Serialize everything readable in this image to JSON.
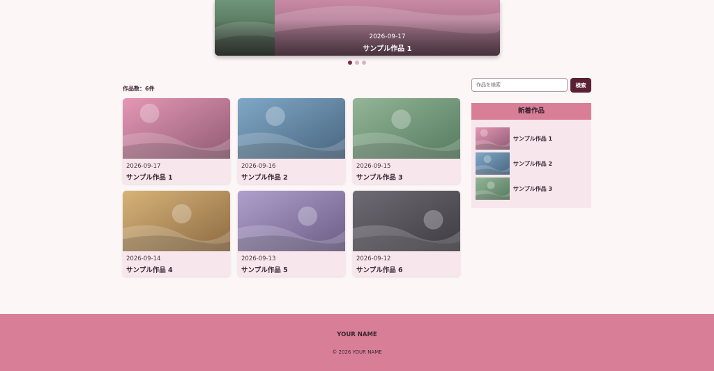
{
  "slider": {
    "date": "2026-09-17",
    "title": "サンプル作品 1",
    "dots": 3,
    "active_dot": 0,
    "colors": {
      "main": [
        "#c889a4",
        "#8c5a74"
      ],
      "prev": [
        "#6f9478",
        "#3e5a44"
      ]
    }
  },
  "main": {
    "count_label": "作品数：6件",
    "cards": [
      {
        "date": "2026-09-17",
        "title": "サンプル作品 1",
        "colors": [
          "#e597b5",
          "#8f5b73"
        ]
      },
      {
        "date": "2026-09-16",
        "title": "サンプル作品 2",
        "colors": [
          "#80a8c7",
          "#48657f"
        ]
      },
      {
        "date": "2026-09-15",
        "title": "サンプル作品 3",
        "colors": [
          "#93b598",
          "#557a5d"
        ]
      },
      {
        "date": "2026-09-14",
        "title": "サンプル作品 4",
        "colors": [
          "#d7b378",
          "#8d6a42"
        ]
      },
      {
        "date": "2026-09-13",
        "title": "サンプル作品 5",
        "colors": [
          "#ae9fcc",
          "#6c5d86"
        ]
      },
      {
        "date": "2026-09-12",
        "title": "サンプル作品 6",
        "colors": [
          "#6e6b74",
          "#3e3c42"
        ]
      }
    ]
  },
  "sidebar": {
    "search_placeholder": "作品を検索",
    "search_button": "検索",
    "recent_heading": "新着作品",
    "recent": [
      {
        "title": "サンプル作品 1",
        "colors": [
          "#e597b5",
          "#8f5b73"
        ]
      },
      {
        "title": "サンプル作品 2",
        "colors": [
          "#80a8c7",
          "#48657f"
        ]
      },
      {
        "title": "サンプル作品 3",
        "colors": [
          "#93b598",
          "#557a5d"
        ]
      }
    ]
  },
  "footer": {
    "name": "YOUR NAME",
    "copyright": "© 2026 YOUR NAME"
  }
}
